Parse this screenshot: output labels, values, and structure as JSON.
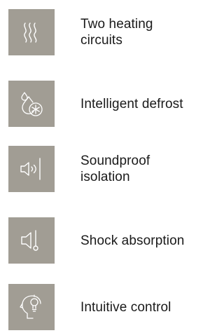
{
  "colors": {
    "tile_background": "#a19d94",
    "icon_stroke": "#ffffff",
    "label_text": "#1a1a1a",
    "page_background": "#ffffff"
  },
  "features": [
    {
      "icon": "heating-circuits-icon",
      "label": "Two heating\ncircuits"
    },
    {
      "icon": "defrost-icon",
      "label": "Intelligent defrost"
    },
    {
      "icon": "soundproof-icon",
      "label": "Soundproof\nisolation"
    },
    {
      "icon": "shock-absorption-icon",
      "label": "Shock absorption"
    },
    {
      "icon": "intuitive-control-icon",
      "label": "Intuitive control"
    }
  ]
}
